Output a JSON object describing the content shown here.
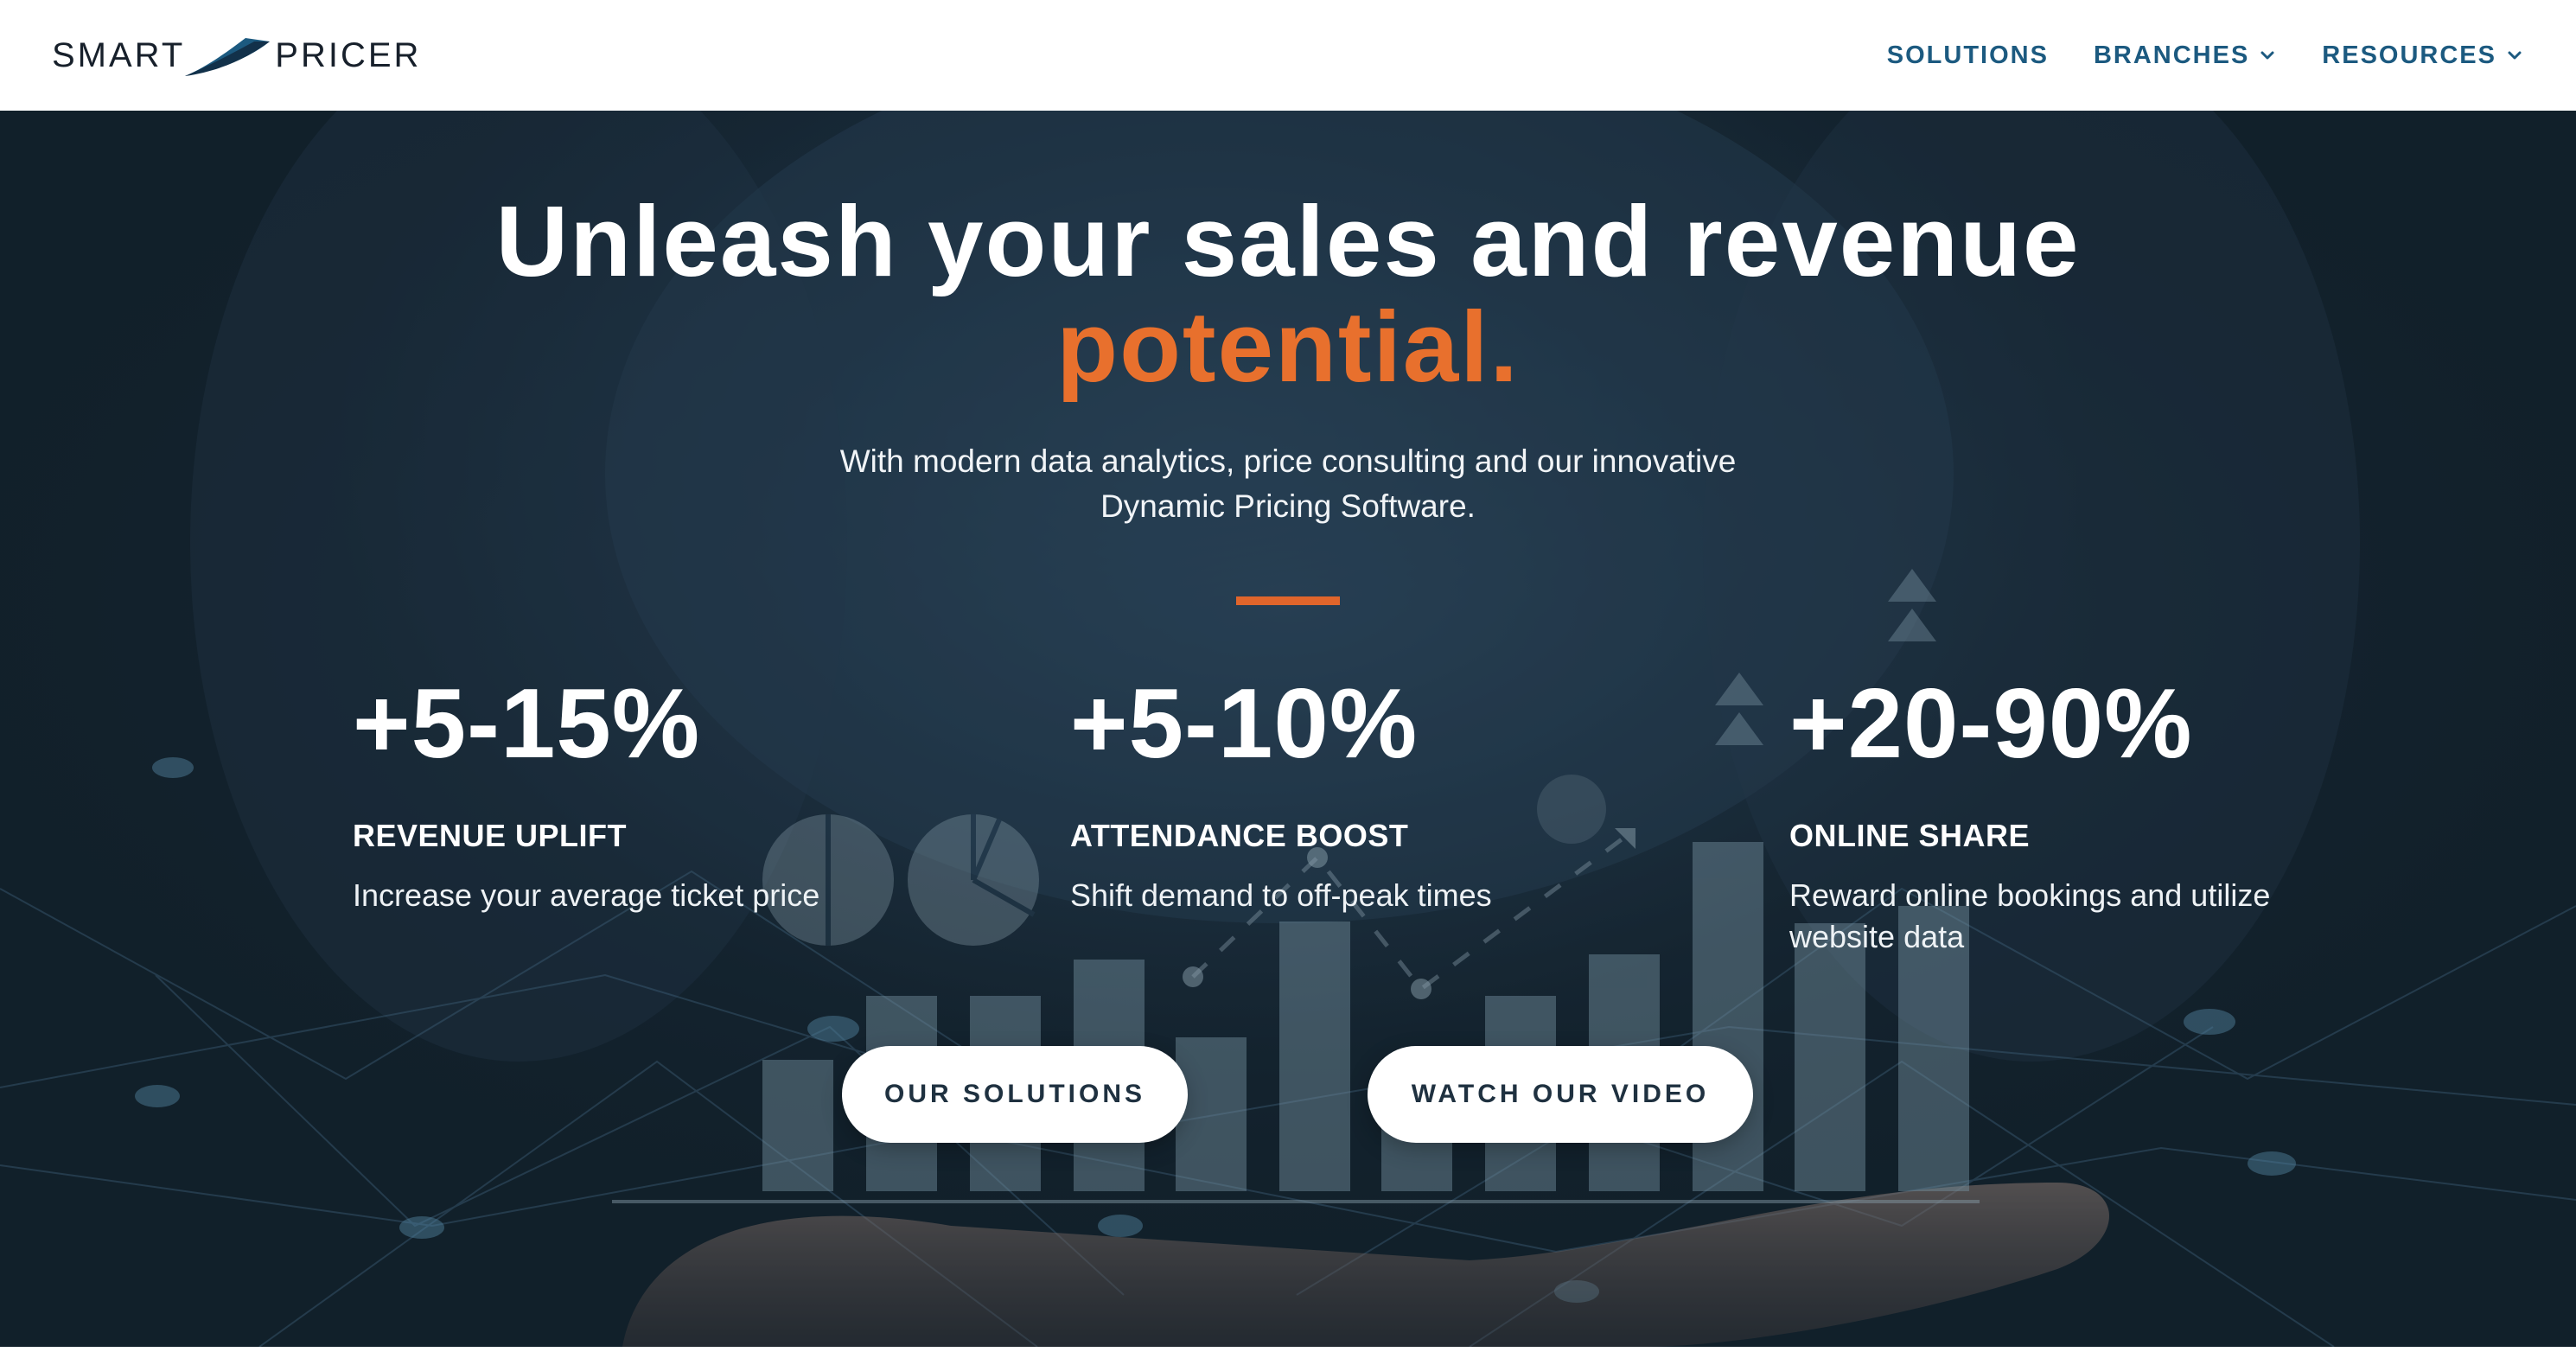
{
  "brand": {
    "name_left": "SMART",
    "name_right": "PRICER",
    "colors": {
      "navy": "#1c5a80",
      "accent": "#e8702d",
      "logo_text": "#17202b"
    }
  },
  "nav": {
    "items": [
      {
        "label": "SOLUTIONS",
        "has_dropdown": false
      },
      {
        "label": "BRANCHES",
        "has_dropdown": true,
        "icon": "chevron-down-icon"
      },
      {
        "label": "RESOURCES",
        "has_dropdown": true,
        "icon": "chevron-down-icon"
      }
    ]
  },
  "hero": {
    "title_line1": "Unleash your sales and revenue",
    "title_accent": "potential.",
    "subtitle": "With modern data analytics, price consulting and our innovative Dynamic Pricing Software.",
    "stats": [
      {
        "value": "+5-15%",
        "label": "REVENUE UPLIFT",
        "description": "Increase your average ticket price"
      },
      {
        "value": "+5-10%",
        "label": "ATTENDANCE BOOST",
        "description": "Shift demand to off-peak times"
      },
      {
        "value": "+20-90%",
        "label": "ONLINE SHARE",
        "description": "Reward online bookings and utilize website data"
      }
    ],
    "buttons": {
      "solutions": "OUR SOLUTIONS",
      "video": "WATCH OUR VIDEO"
    }
  }
}
